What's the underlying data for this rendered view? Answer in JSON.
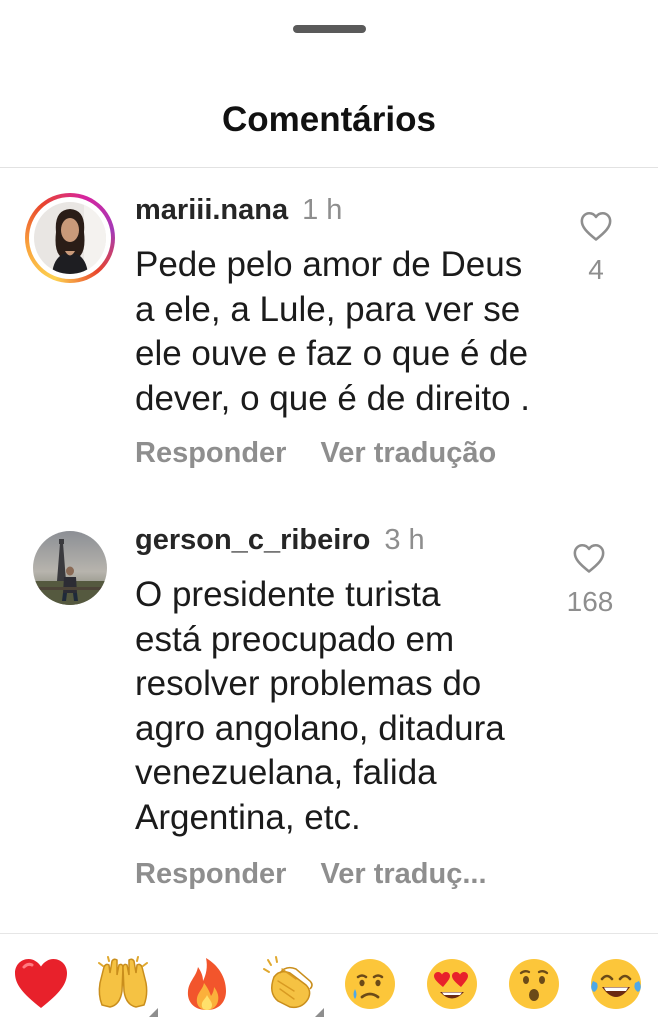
{
  "sheet": {
    "title": "Comentários"
  },
  "comments": [
    {
      "username": "mariii.nana",
      "time": "1 h",
      "text_lines": [
        "Pede pelo amor de Deus",
        "a ele, a Lule, para ver se",
        "ele ouve e faz o que é de",
        "dever, o que é de direito ."
      ],
      "like_count": "4",
      "reply_label": "Responder",
      "translate_label": "Ver tradução",
      "has_story_ring": true,
      "icon": "heart-outline-icon"
    },
    {
      "username": "gerson_c_ribeiro",
      "time": "3 h",
      "text_lines": [
        "O presidente turista",
        "está preocupado em",
        "resolver problemas do",
        "agro angolano, ditadura",
        "venezuelana, falida",
        "Argentina, etc."
      ],
      "like_count": "168",
      "reply_label": "Responder",
      "translate_label": "Ver traduç...",
      "has_story_ring": false,
      "icon": "heart-outline-icon"
    }
  ],
  "reactions": [
    {
      "name": "red-heart",
      "glyph": "❤️"
    },
    {
      "name": "raising-hands",
      "glyph": "🙌"
    },
    {
      "name": "fire",
      "glyph": "🔥"
    },
    {
      "name": "clapping-hands",
      "glyph": "👏"
    },
    {
      "name": "crying-face",
      "glyph": "😢"
    },
    {
      "name": "heart-eyes",
      "glyph": "😍"
    },
    {
      "name": "astonished-face",
      "glyph": "😮"
    },
    {
      "name": "tears-of-joy",
      "glyph": "😂"
    }
  ],
  "colors": {
    "text_primary": "#262626",
    "text_secondary": "#8e8e8e",
    "heart_red": "#ed1c24",
    "emoji_yellow": "#ffc83d"
  }
}
